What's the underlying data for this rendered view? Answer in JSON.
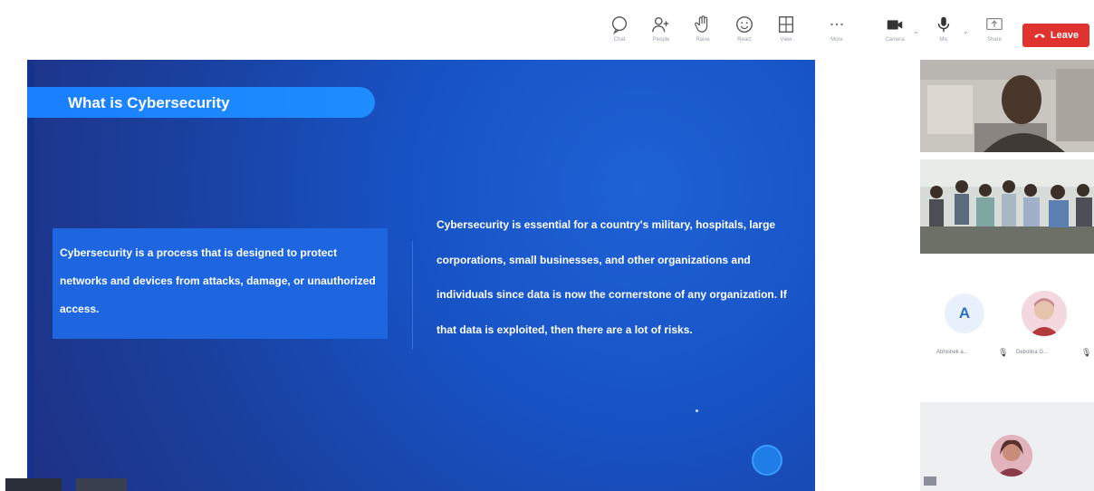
{
  "toolbar": {
    "items": [
      {
        "icon": "chat-icon",
        "label": "Chat"
      },
      {
        "icon": "people-icon",
        "label": "People"
      },
      {
        "icon": "raise-hand-icon",
        "label": "Raise"
      },
      {
        "icon": "react-icon",
        "label": "React"
      },
      {
        "icon": "view-icon",
        "label": "View"
      },
      {
        "icon": "more-icon",
        "label": "More"
      },
      {
        "icon": "camera-icon",
        "label": "Camera"
      },
      {
        "icon": "mic-icon",
        "label": "Mic"
      },
      {
        "icon": "share-icon",
        "label": "Share"
      }
    ],
    "leave_label": "Leave",
    "leave_color": "#e0322f"
  },
  "slide": {
    "title": "What is Cybersecurity",
    "left_text": "Cybersecurity is a process that is designed to protect networks and devices from attacks, damage, or unauthorized access.",
    "right_text": "Cybersecurity is essential for a country's military, hospitals, large corporations, small businesses, and other organizations and individuals since data is now the cornerstone of any organization. If that data is exploited, then there are a lot of risks.",
    "accent": "#1a7fff",
    "background": "#1752c4"
  },
  "participants": {
    "avatar_letter": "A",
    "names": [
      "Abhishek a...",
      "Debolina G..."
    ]
  }
}
